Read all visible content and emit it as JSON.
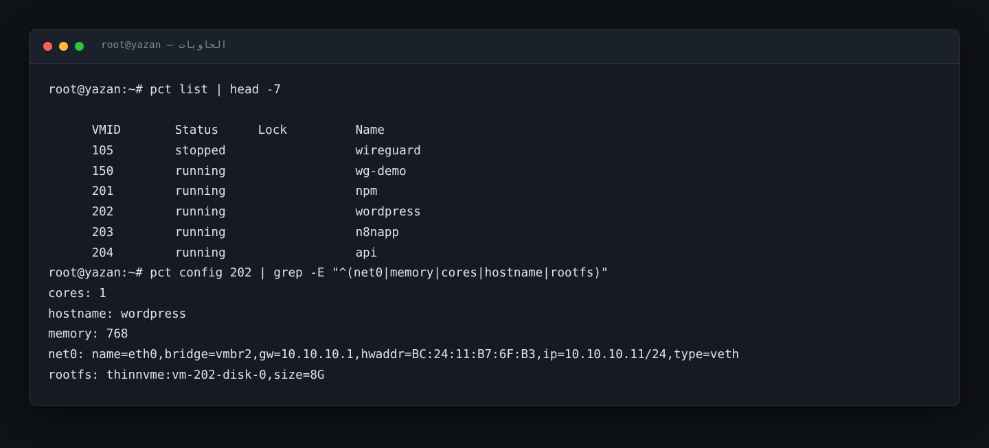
{
  "window": {
    "title": "root@yazan — الحاويات"
  },
  "terminal": {
    "command1": "root@yazan:~# pct list | head -7",
    "table": {
      "headers": [
        "VMID",
        "Status",
        "Lock",
        "Name"
      ],
      "rows": [
        [
          "105",
          "stopped",
          "",
          "wireguard"
        ],
        [
          "150",
          "running",
          "",
          "wg-demo"
        ],
        [
          "201",
          "running",
          "",
          "npm"
        ],
        [
          "202",
          "running",
          "",
          "wordpress"
        ],
        [
          "203",
          "running",
          "",
          "n8napp"
        ],
        [
          "204",
          "running",
          "",
          "api"
        ]
      ]
    },
    "command2": "root@yazan:~# pct config 202 | grep -E \"^(net0|memory|cores|hostname|rootfs)\"",
    "output": [
      "cores: 1",
      "hostname: wordpress",
      "memory: 768",
      "net0: name=eth0,bridge=vmbr2,gw=10.10.10.1,hwaddr=BC:24:11:B7:6F:B3,ip=10.10.10.11/24,type=veth",
      "rootfs: thinnvme:vm-202-disk-0,size=8G"
    ]
  },
  "colors": {
    "page_background": "#0f1217",
    "window_background": "#161b22",
    "titlebar_background": "#1b212b",
    "text": "#dfe3ea",
    "close": "#ff5f57",
    "minimize": "#febc2e",
    "maximize": "#28c840"
  }
}
